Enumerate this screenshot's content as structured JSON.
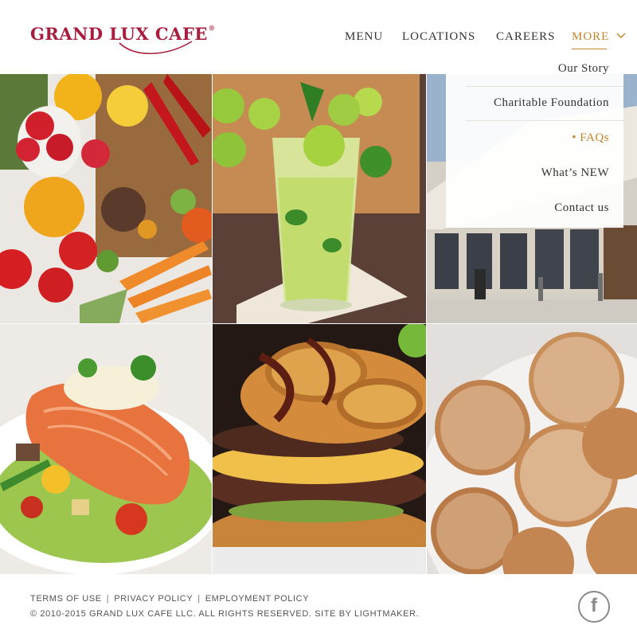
{
  "header": {
    "logo": "GRAND LUX CAFE",
    "logo_mark": "®",
    "nav": {
      "menu": "MENU",
      "locations": "LOCATIONS",
      "careers": "CAREERS",
      "more": "MORE"
    },
    "more_icon": "chevron-down-icon"
  },
  "dropdown": {
    "items": [
      {
        "label": "Our Story"
      },
      {
        "label": "Charitable Foundation"
      },
      {
        "label": "• FAQs",
        "active": true
      },
      {
        "label": "What’s NEW"
      },
      {
        "label": "Contact us"
      }
    ]
  },
  "grid": {
    "tiles": [
      "fresh-produce-photo",
      "mojito-drink-photo",
      "restaurant-exterior-photo",
      "salmon-dish-photo",
      "burger-photo",
      "sugar-donuts-photo"
    ]
  },
  "footer": {
    "links": {
      "terms": "TERMS OF USE",
      "privacy": "PRIVACY POLICY",
      "employment": "EMPLOYMENT POLICY",
      "separator": "|"
    },
    "copyright": "© 2010-2015 GRAND LUX CAFE LLC. ALL RIGHTS RESERVED. SITE BY LIGHTMAKER.",
    "social_icon": "facebook-icon",
    "social_glyph": "f"
  },
  "colors": {
    "brand": "#a81d3e",
    "accent": "#c1862c",
    "text": "#333333"
  }
}
